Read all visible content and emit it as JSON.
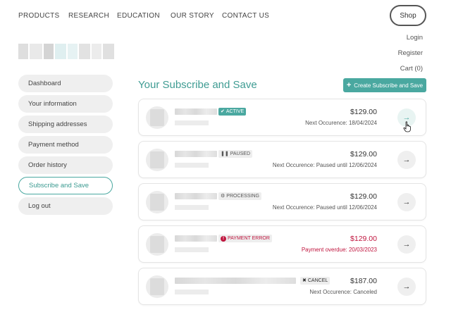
{
  "nav": {
    "products": "PRODUCTS",
    "research": "RESEARCH",
    "education": "EDUCATION",
    "our_story": "OUR STORY",
    "contact_us": "CONTACT US",
    "shop": "Shop"
  },
  "account_menu": {
    "login": "Login",
    "register": "Register",
    "cart": "Cart (0)"
  },
  "sidebar": {
    "items": [
      {
        "label": "Dashboard"
      },
      {
        "label": "Your information"
      },
      {
        "label": "Shipping addresses"
      },
      {
        "label": "Payment method"
      },
      {
        "label": "Order history"
      },
      {
        "label": "Subscribe and Save",
        "active": true
      },
      {
        "label": "Log out"
      }
    ]
  },
  "main": {
    "title": "Your Subscribe and Save",
    "create_button": "Create Subscribe and Save"
  },
  "subscriptions": [
    {
      "status": "ACTIVE",
      "price": "$129.00",
      "next": "Next Occurence: 18/04/2024"
    },
    {
      "status": "PAUSED",
      "price": "$129.00",
      "next": "Next Occurence: Paused until 12/06/2024"
    },
    {
      "status": "PROCESSING",
      "price": "$129.00",
      "next": "Next Occurence: Paused until 12/06/2024"
    },
    {
      "status": "PAYMENT ERROR",
      "price": "$129.00",
      "next": "Payment overdue: 20/03/2023"
    },
    {
      "status": "CANCEL",
      "price": "$187.00",
      "next": "Next Occurence: Canceled"
    }
  ],
  "colors": {
    "accent": "#4aa8a0",
    "error": "#c0163f"
  }
}
